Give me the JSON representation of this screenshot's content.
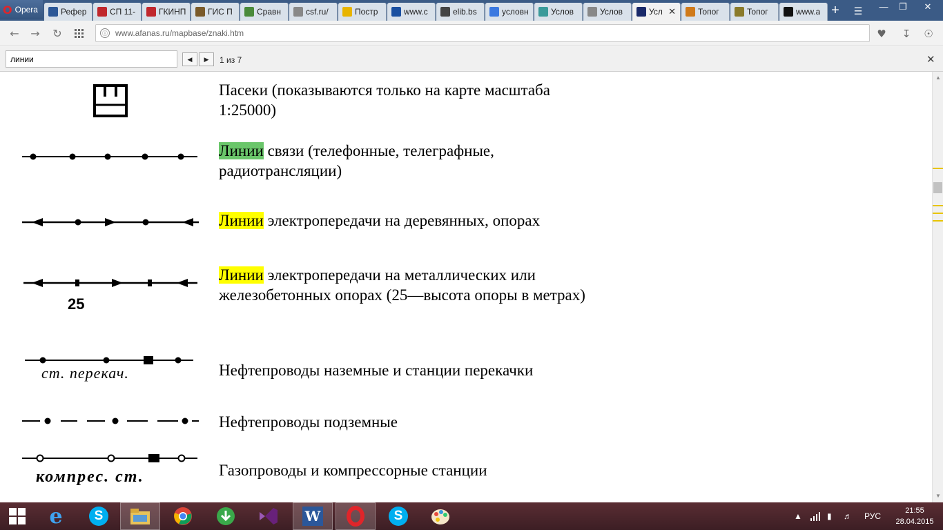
{
  "browser": {
    "menu_label": "Opera",
    "tabs": [
      {
        "label": "Рефер",
        "icon": "graduation-cap-icon",
        "color": "#2b5797"
      },
      {
        "label": "СП 11-",
        "icon": "document-red-icon",
        "color": "#c0272d"
      },
      {
        "label": "ГКИНП",
        "icon": "document-red-icon",
        "color": "#c0272d"
      },
      {
        "label": "ГИС П",
        "icon": "building-icon",
        "color": "#7a5a2a"
      },
      {
        "label": "Сравн",
        "icon": "globe-icon",
        "color": "#4a8a3a"
      },
      {
        "label": "csf.ru/",
        "icon": "page-icon",
        "color": "#888888"
      },
      {
        "label": "Постр",
        "icon": "smiley-icon",
        "color": "#e8b400"
      },
      {
        "label": "www.c",
        "icon": "link-icon",
        "color": "#1a4fa0"
      },
      {
        "label": "elib.bs",
        "icon": "book-icon",
        "color": "#444444"
      },
      {
        "label": "условн",
        "icon": "google-icon",
        "color": "#3a78e0"
      },
      {
        "label": "Услов",
        "icon": "map-icon",
        "color": "#3a9a9a"
      },
      {
        "label": "Услов",
        "icon": "page-icon",
        "color": "#888888"
      },
      {
        "label": "Усл",
        "icon": "map-dark-icon",
        "color": "#1a2a6a",
        "active": true
      },
      {
        "label": "Топог",
        "icon": "flower-icon",
        "color": "#d07a1a"
      },
      {
        "label": "Топог",
        "icon": "emblem-icon",
        "color": "#8a7a2a"
      },
      {
        "label": "www.a",
        "icon": "circle-icon",
        "color": "#111111"
      }
    ],
    "new_tab_symbol": "+",
    "url": "www.afanas.ru/mapbase/znaki.htm"
  },
  "find_bar": {
    "query": "линии",
    "count": "1 из 7"
  },
  "legend": [
    {
      "highlight": "",
      "before": "",
      "text": "Пасеки (показываются только на карте масштаба 1:25000)"
    },
    {
      "highlight": "green",
      "mark": "Линии",
      "text": " связи (телефонные, телеграфные, радиотрансляции)"
    },
    {
      "highlight": "yellow",
      "mark": "Линии",
      "text": " электропередачи на деревянных, опорах"
    },
    {
      "highlight": "yellow",
      "mark": "Линии",
      "text": " электропередачи на металлических или железобетонных опорах (25—высота опоры в метрах)"
    },
    {
      "highlight": "",
      "text": "Нефтепроводы наземные и станции перекачки"
    },
    {
      "highlight": "",
      "text": "Нефтепроводы подземные"
    },
    {
      "highlight": "",
      "text": "Газопроводы и компрессорные станции"
    }
  ],
  "symbol_labels": {
    "pole_height": "25",
    "pump_station": "ст. перекач.",
    "compressor_station": "компрес. ст."
  },
  "taskbar": {
    "apps": [
      "start-icon",
      "ie-icon",
      "skype-icon",
      "file-explorer-icon",
      "chrome-icon",
      "download-icon",
      "visual-studio-icon",
      "word-icon",
      "opera-icon",
      "skype-icon",
      "paint-icon"
    ],
    "language": "РУС",
    "time": "21:55",
    "date": "28.04.2015"
  }
}
